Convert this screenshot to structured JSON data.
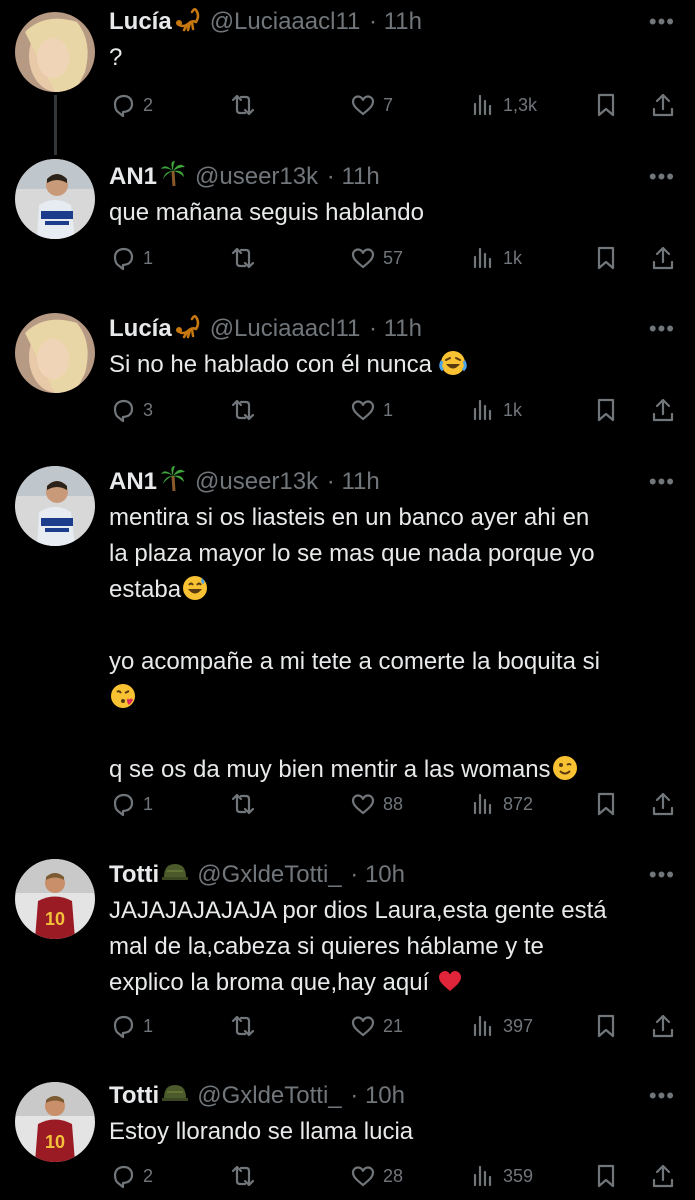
{
  "tweets": [
    {
      "avatar_kind": "lucia",
      "name": "Lucía",
      "name_emoji": "scorpion-emoji",
      "handle": "@Luciaaacl11",
      "time": "· 11h",
      "text": "?",
      "replies": "2",
      "likes": "7",
      "views": "1,3k"
    },
    {
      "avatar_kind": "an1",
      "name": "AN1",
      "name_emoji": "palm-tree-emoji",
      "handle": "@useer13k",
      "time": "· 11h",
      "text": "que mañana seguis hablando",
      "replies": "1",
      "likes": "57",
      "views": "1k"
    },
    {
      "avatar_kind": "lucia",
      "name": "Lucía",
      "name_emoji": "scorpion-emoji",
      "handle": "@Luciaaacl11",
      "time": "· 11h",
      "text": "Si no he hablado con él nunca ",
      "text_emoji": "crying-laughing-emoji",
      "replies": "3",
      "likes": "1",
      "views": "1k"
    },
    {
      "avatar_kind": "an1",
      "name": "AN1",
      "name_emoji": "palm-tree-emoji",
      "handle": "@useer13k",
      "time": "· 11h",
      "lines": [
        "mentira si os liasteis en un banco ayer ahi en",
        "la plaza mayor lo se mas que nada porque yo",
        "estaba",
        "",
        "yo acompañe a mi tete a comerte la boquita si",
        "",
        "",
        "q se os da muy bien mentir a las womans"
      ],
      "replies": "1",
      "likes": "88",
      "views": "872"
    },
    {
      "avatar_kind": "totti",
      "name": "Totti",
      "name_emoji": "military-helmet-emoji",
      "handle": "@GxldeTotti_",
      "time": "· 10h",
      "lines": [
        "JAJAJAJAJAJA por dios Laura,esta gente está",
        "mal de la,cabeza si quieres háblame y te",
        "explico la broma que,hay aquí "
      ],
      "replies": "1",
      "likes": "21",
      "views": "397"
    },
    {
      "avatar_kind": "totti",
      "name": "Totti",
      "name_emoji": "military-helmet-emoji",
      "handle": "@GxldeTotti_",
      "time": "· 10h",
      "text": "Estoy llorando se llama lucia",
      "replies": "2",
      "likes": "28",
      "views": "359"
    }
  ],
  "colors": {
    "background": "#000000",
    "text": "#e7e9ea",
    "muted": "#71767b",
    "thread_line": "#333639"
  },
  "icons": [
    "reply-icon",
    "retweet-icon",
    "like-icon",
    "views-icon",
    "bookmark-icon",
    "share-icon",
    "more-icon"
  ]
}
